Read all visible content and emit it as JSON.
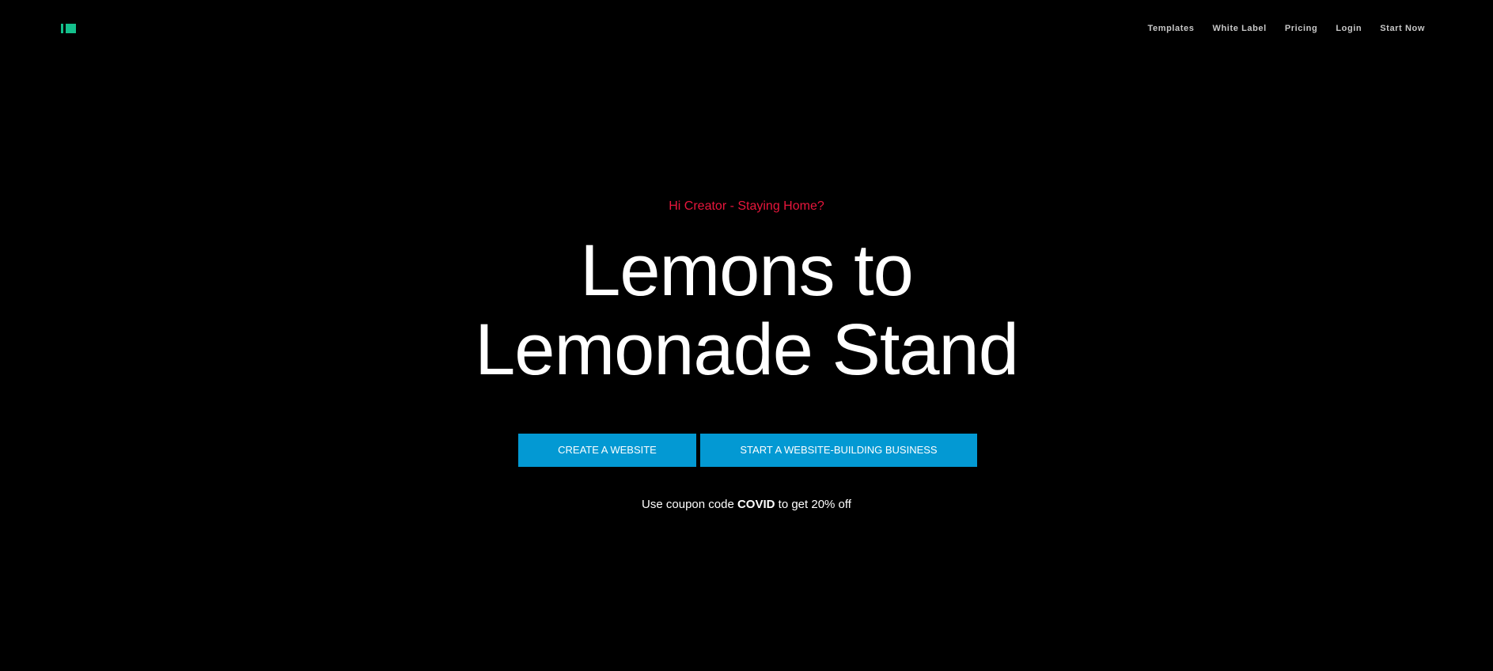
{
  "header": {
    "logo_name": "brand-logo",
    "brand_color": "#14c08c",
    "nav": [
      {
        "label": "Templates"
      },
      {
        "label": "White Label"
      },
      {
        "label": "Pricing"
      },
      {
        "label": "Login"
      },
      {
        "label": "Start Now"
      }
    ]
  },
  "hero": {
    "eyebrow": "Hi Creator - Staying Home?",
    "eyebrow_color": "#e8163c",
    "headline_line1": "Lemons to",
    "headline_line2": "Lemonade Stand",
    "buttons": {
      "create_label": "CREATE A WEBSITE",
      "business_label": "START A WEBSITE-BUILDING BUSINESS",
      "color": "#0399d3"
    },
    "coupon": {
      "prefix": "Use coupon code ",
      "code": "COVID",
      "suffix": " to get 20% off"
    }
  }
}
